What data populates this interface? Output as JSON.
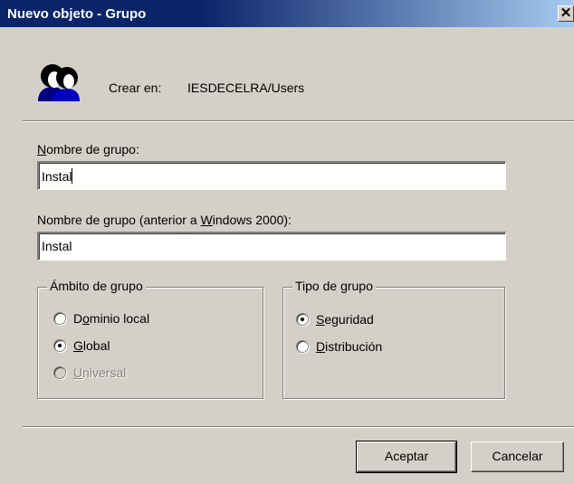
{
  "window": {
    "title": "Nuevo objeto - Grupo",
    "close_glyph": "✕"
  },
  "create_in": {
    "label": "Crear en:",
    "value": "IESDECELRA/Users"
  },
  "group_name": {
    "label_pre": "",
    "label_u": "N",
    "label_post": "ombre de grupo:",
    "value": "Instal"
  },
  "group_name_legacy": {
    "label_pre": "Nombre de grupo (anterior a ",
    "label_u": "W",
    "label_post": "indows 2000):",
    "value": "Instal"
  },
  "scope": {
    "title": "Ámbito de grupo",
    "options": [
      {
        "pre": "D",
        "u": "o",
        "post": "minio local",
        "checked": false,
        "enabled": true
      },
      {
        "pre": "",
        "u": "G",
        "post": "lobal",
        "checked": true,
        "enabled": true
      },
      {
        "pre": "",
        "u": "U",
        "post": "niversal",
        "checked": false,
        "enabled": false
      }
    ]
  },
  "type": {
    "title": "Tipo de grupo",
    "options": [
      {
        "pre": "",
        "u": "S",
        "post": "eguridad",
        "checked": true,
        "enabled": true
      },
      {
        "pre": "",
        "u": "D",
        "post": "istribución",
        "checked": false,
        "enabled": true
      }
    ]
  },
  "buttons": {
    "ok": "Aceptar",
    "cancel": "Cancelar"
  },
  "icons": {
    "group": "group-users-icon"
  }
}
